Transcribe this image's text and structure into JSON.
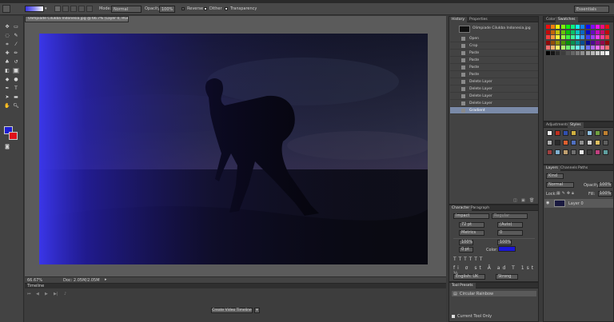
{
  "options_bar": {
    "mode_label": "Mode:",
    "mode_value": "Normal",
    "opacity_label": "Opacity:",
    "opacity_value": "100%",
    "reverse_label": "Reverse",
    "dither_label": "Dither",
    "transparency_label": "Transparency",
    "workspace_value": "Essentials"
  },
  "document": {
    "tab_title": "Olimpiade Cilukba Indonesia.jpg @ 66.7% (Layer 0, RGB/8) *",
    "zoom": "66.67%",
    "doc_info": "Doc: 2.05M/2.05M"
  },
  "history": {
    "tab": "History",
    "tab2": "Properties",
    "snapshot_label": "Olimpiade Cilukba Indonesia.jpg",
    "items": [
      "Open",
      "Crop",
      "Paste",
      "Paste",
      "Paste",
      "Paste",
      "Delete Layer",
      "Delete Layer",
      "Delete Layer",
      "Delete Layer",
      "Gradient"
    ]
  },
  "swatches": {
    "tab1": "Color",
    "tab2": "Swatches"
  },
  "adjustments": {
    "tab1": "Adjustments",
    "tab2": "Styles"
  },
  "layers": {
    "tab1": "Layers",
    "tab2": "Channels",
    "tab3": "Paths",
    "kind_label": "Kind",
    "blend_value": "Normal",
    "opacity_label": "Opacity:",
    "opacity_value": "100%",
    "lock_label": "Lock:",
    "fill_label": "Fill:",
    "fill_value": "100%",
    "layer_name": "Layer 0"
  },
  "character": {
    "tab1": "Character",
    "tab2": "Paragraph",
    "font_family": "Impact",
    "font_style": "Regular",
    "size": "72 pt",
    "leading": "(Auto)",
    "kerning": "Metrics",
    "tracking": "0",
    "vscale": "100%",
    "hscale": "100%",
    "baseline": "0 pt",
    "color_label": "Color:",
    "language": "English: UK",
    "aa": "Strong",
    "text_color": "#1c17d8"
  },
  "tool_presets": {
    "tab": "Tool Presets",
    "item": "Circular Rainbow",
    "footer": "Current Tool Only"
  },
  "timeline": {
    "tab": "Timeline",
    "button": "Create Video Timeline"
  },
  "colors": {
    "foreground": "#1e1ed2",
    "background": "#e0101a",
    "gradient_start": "#3a36e8",
    "selected_row": "#7a8aa8"
  }
}
